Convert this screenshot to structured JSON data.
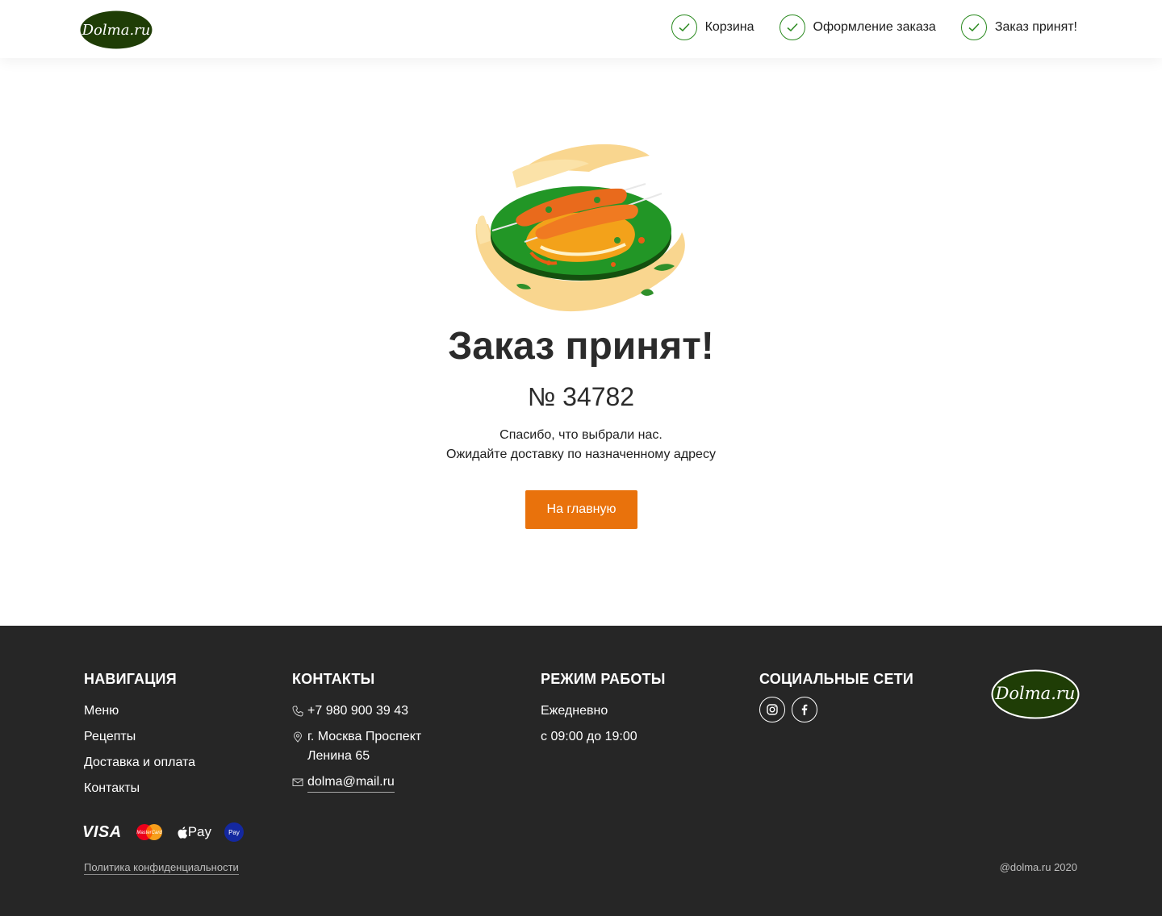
{
  "header": {
    "logo_text": "Dolma.ru",
    "steps": [
      {
        "label": "Корзина"
      },
      {
        "label": "Оформление заказа"
      },
      {
        "label": "Заказ принят!"
      }
    ]
  },
  "main": {
    "title": "Заказ принят!",
    "order_number": "№ 34782",
    "message_line1": "Спасибо, что выбрали нас.",
    "message_line2": "Ожидайте доставку по назначенному адресу",
    "home_button": "На главную"
  },
  "footer": {
    "navigation": {
      "title": "НАВИГАЦИЯ",
      "links": [
        "Меню",
        "Рецепты",
        "Доставка и оплата",
        "Контакты"
      ]
    },
    "contacts": {
      "title": "КОНТАКТЫ",
      "phone": "+7 980 900 39 43",
      "address_line1": "г. Москва Проспект",
      "address_line2": "Ленина 65",
      "email": "dolma@mail.ru"
    },
    "hours": {
      "title": "РЕЖИМ РАБОТЫ",
      "days": "Ежедневно",
      "time": "с 09:00 до 19:00"
    },
    "social": {
      "title": "СОЦИАЛЬНЫЕ СЕТИ"
    },
    "payments": {
      "visa": "VISA",
      "mastercard": "MasterCard",
      "apple_pay": "Pay",
      "samsung_pay": "Pay"
    },
    "policy": "Политика конфиденциальности",
    "copyright": "@dolma.ru 2020"
  },
  "colors": {
    "accent": "#e9720c",
    "brand_green": "#2a8a1f",
    "logo_green": "#1f3d06",
    "footer_bg": "#262626"
  }
}
